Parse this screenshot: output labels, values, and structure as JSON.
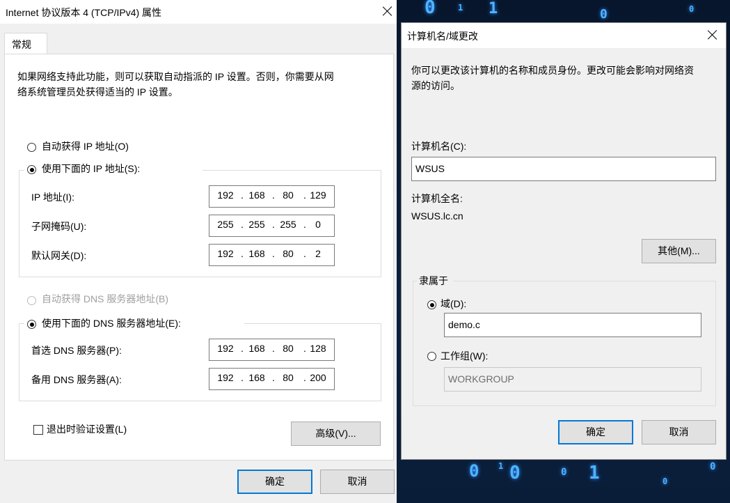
{
  "left_dialog": {
    "title": "Internet 协议版本 4 (TCP/IPv4) 属性",
    "tab": "常规",
    "description_line1": "如果网络支持此功能，则可以获取自动指派的 IP 设置。否则，你需要从网",
    "description_line2": "络系统管理员处获得适当的 IP 设置。",
    "radio_auto_ip": "自动获得 IP 地址(O)",
    "radio_manual_ip": "使用下面的 IP 地址(S):",
    "ip_label": "IP 地址(I):",
    "ip": [
      "192",
      "168",
      "80",
      "129"
    ],
    "mask_label": "子网掩码(U):",
    "mask": [
      "255",
      "255",
      "255",
      "0"
    ],
    "gateway_label": "默认网关(D):",
    "gateway": [
      "192",
      "168",
      "80",
      "2"
    ],
    "radio_auto_dns": "自动获得 DNS 服务器地址(B)",
    "radio_manual_dns": "使用下面的 DNS 服务器地址(E):",
    "dns1_label": "首选 DNS 服务器(P):",
    "dns1": [
      "192",
      "168",
      "80",
      "128"
    ],
    "dns2_label": "备用 DNS 服务器(A):",
    "dns2": [
      "192",
      "168",
      "80",
      "200"
    ],
    "validate_checkbox": "退出时验证设置(L)",
    "advanced_button": "高级(V)...",
    "ok_button": "确定",
    "cancel_button": "取消"
  },
  "right_dialog": {
    "title": "计算机名/域更改",
    "description_line1": "你可以更改该计算机的名称和成员身份。更改可能会影响对网络资",
    "description_line2": "源的访问。",
    "computer_name_label": "计算机名(C):",
    "computer_name_value": "WSUS",
    "full_name_label": "计算机全名:",
    "full_name_value": "WSUS.lc.cn",
    "more_button": "其他(M)...",
    "member_of_label": "隶属于",
    "domain_radio": "域(D):",
    "domain_value": "demo.c",
    "workgroup_radio": "工作组(W):",
    "workgroup_value": "WORKGROUP",
    "ok_button": "确定",
    "cancel_button": "取消"
  },
  "icons": {
    "close": "close-icon",
    "radio": "radio-icon",
    "checkbox": "checkbox-icon"
  },
  "colors": {
    "accent": "#0078d7",
    "dialog_bg": "#f0f0f0",
    "disabled_text": "#a0a0a0"
  }
}
